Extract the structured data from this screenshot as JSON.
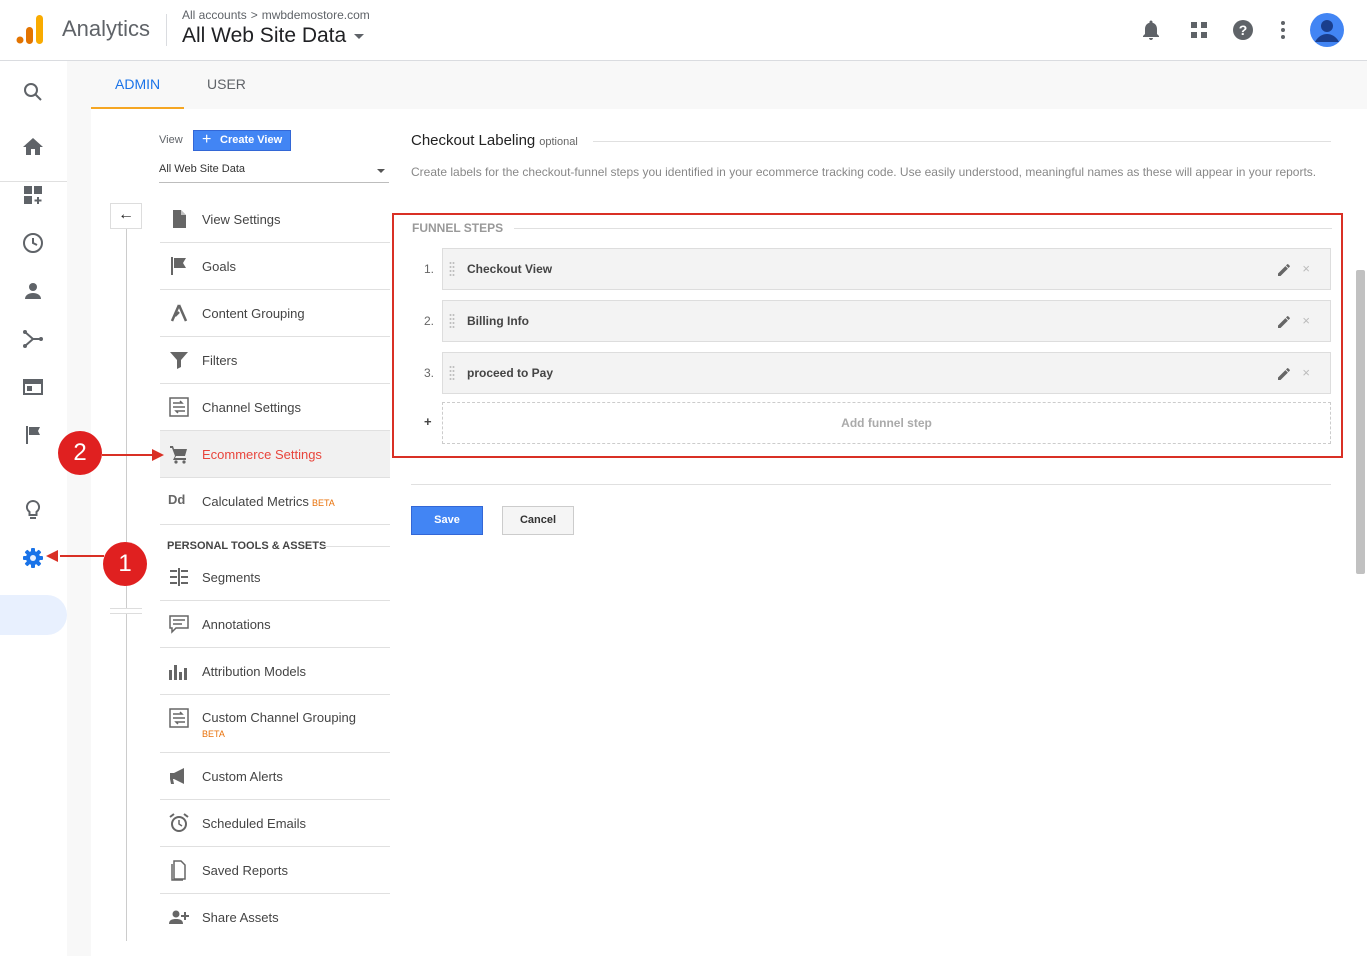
{
  "header": {
    "product_name": "Analytics",
    "breadcrumb_root": "All accounts",
    "breadcrumb_sep": ">",
    "breadcrumb_account": "mwbdemostore.com",
    "view_title": "All Web Site Data",
    "icons": [
      "bell-icon",
      "apps-grid-icon",
      "help-icon",
      "more-vert-icon",
      "avatar"
    ]
  },
  "rail": {
    "icons": [
      "search-icon",
      "home-icon",
      "customization-icon",
      "realtime-clock-icon",
      "audience-person-icon",
      "acquisition-icon",
      "behavior-icon",
      "conversions-flag-icon",
      "discover-lightbulb-icon",
      "admin-gear-icon"
    ]
  },
  "tabs": {
    "admin": "ADMIN",
    "user": "USER"
  },
  "view_column": {
    "view_label": "View",
    "create_view": "Create View",
    "selected_view": "All Web Site Data",
    "back_symbol": "←",
    "items": [
      {
        "label": "View Settings",
        "icon": "document-icon"
      },
      {
        "label": "Goals",
        "icon": "flag-icon"
      },
      {
        "label": "Content Grouping",
        "icon": "content-grouping-icon"
      },
      {
        "label": "Filters",
        "icon": "filter-icon"
      },
      {
        "label": "Channel Settings",
        "icon": "channel-settings-icon"
      },
      {
        "label": "Ecommerce Settings",
        "icon": "cart-icon"
      },
      {
        "label": "Calculated Metrics",
        "beta": "BETA",
        "icon": "calculated-metrics-icon",
        "icon_text": "Dd"
      }
    ],
    "section_header": "PERSONAL TOOLS & ASSETS",
    "personal_items": [
      {
        "label": "Segments",
        "icon": "segments-icon"
      },
      {
        "label": "Annotations",
        "icon": "annotations-icon"
      },
      {
        "label": "Attribution Models",
        "icon": "attribution-icon"
      },
      {
        "label": "Custom Channel Grouping",
        "beta": "BETA",
        "icon": "custom-channel-icon"
      },
      {
        "label": "Custom Alerts",
        "icon": "megaphone-icon"
      },
      {
        "label": "Scheduled Emails",
        "icon": "alarm-clock-icon"
      },
      {
        "label": "Saved Reports",
        "icon": "saved-reports-icon"
      },
      {
        "label": "Share Assets",
        "icon": "share-assets-icon"
      }
    ]
  },
  "main": {
    "title": "Checkout Labeling",
    "title_optional": "optional",
    "description": "Create labels for the checkout-funnel steps you identified in your ecommerce tracking code. Use easily understood, meaningful names as these will appear in your reports.",
    "funnel_header": "FUNNEL STEPS",
    "steps": [
      {
        "num": "1.",
        "label": "Checkout View"
      },
      {
        "num": "2.",
        "label": "Billing Info"
      },
      {
        "num": "3.",
        "label": "proceed to Pay"
      }
    ],
    "add_plus": "+",
    "add_step": "Add funnel step",
    "save": "Save",
    "cancel": "Cancel"
  },
  "annotations": {
    "badge_1": "1",
    "badge_2": "2"
  },
  "colors": {
    "accent": "#4285f4",
    "highlight": "#d93025",
    "active_text": "#e8453c",
    "tab_underline": "#f5a623"
  }
}
